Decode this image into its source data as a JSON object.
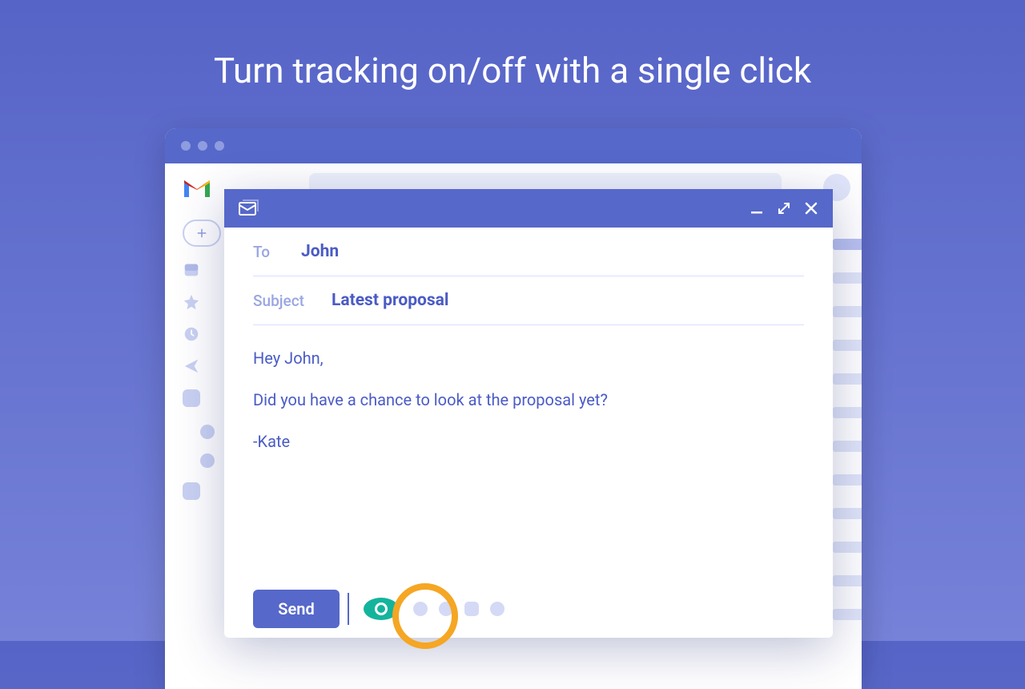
{
  "headline": "Turn tracking on/off with a single click",
  "compose": {
    "to_label": "To",
    "to_value": "John",
    "subject_label": "Subject",
    "subject_value": "Latest proposal",
    "body_line1": "Hey John,",
    "body_line2": "Did you have a chance to look at the proposal yet?",
    "body_sign": "-Kate",
    "send_label": "Send"
  }
}
